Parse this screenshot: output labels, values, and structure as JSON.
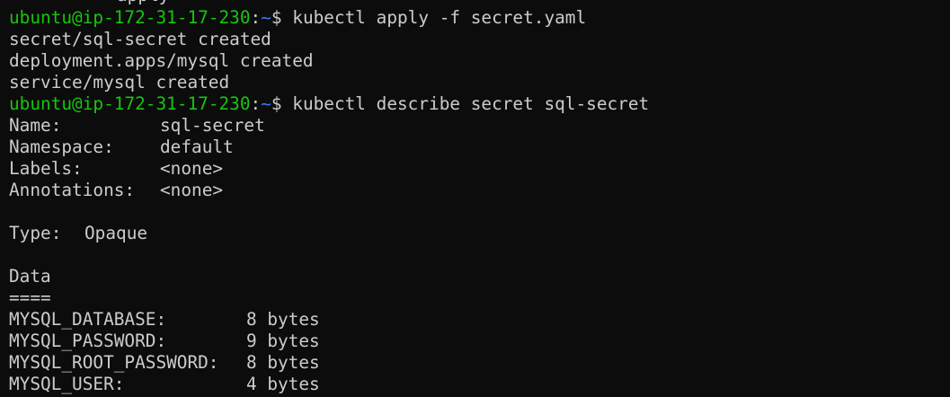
{
  "terminal": {
    "clipped_top": "apply",
    "commands": [
      {
        "user_host": "ubuntu@ip-172-31-17-230",
        "sep": ":",
        "path": "~",
        "prompt": "$",
        "command": "kubectl apply -f secret.yaml"
      },
      {
        "user_host": "ubuntu@ip-172-31-17-230",
        "sep": ":",
        "path": "~",
        "prompt": "$",
        "command": "kubectl describe secret sql-secret"
      }
    ],
    "apply_output": [
      "secret/sql-secret created",
      "deployment.apps/mysql created",
      "service/mysql created"
    ],
    "describe": {
      "fields": [
        {
          "key": "Name:",
          "value": "sql-secret"
        },
        {
          "key": "Namespace:",
          "value": "default"
        },
        {
          "key": "Labels:",
          "value": "<none>"
        },
        {
          "key": "Annotations:",
          "value": "<none>"
        }
      ],
      "type": {
        "key": "Type:",
        "value": "Opaque"
      },
      "data_heading": "Data",
      "data_rule": "====",
      "data": [
        {
          "key": "MYSQL_DATABASE:",
          "value": "8 bytes"
        },
        {
          "key": "MYSQL_PASSWORD:",
          "value": "9 bytes"
        },
        {
          "key": "MYSQL_ROOT_PASSWORD:",
          "value": "8 bytes"
        },
        {
          "key": "MYSQL_USER:",
          "value": "4 bytes"
        }
      ]
    },
    "colors": {
      "background": "#0c0c0c",
      "text": "#cccccc",
      "user_host": "#16c60c",
      "path": "#3b78ff"
    }
  }
}
